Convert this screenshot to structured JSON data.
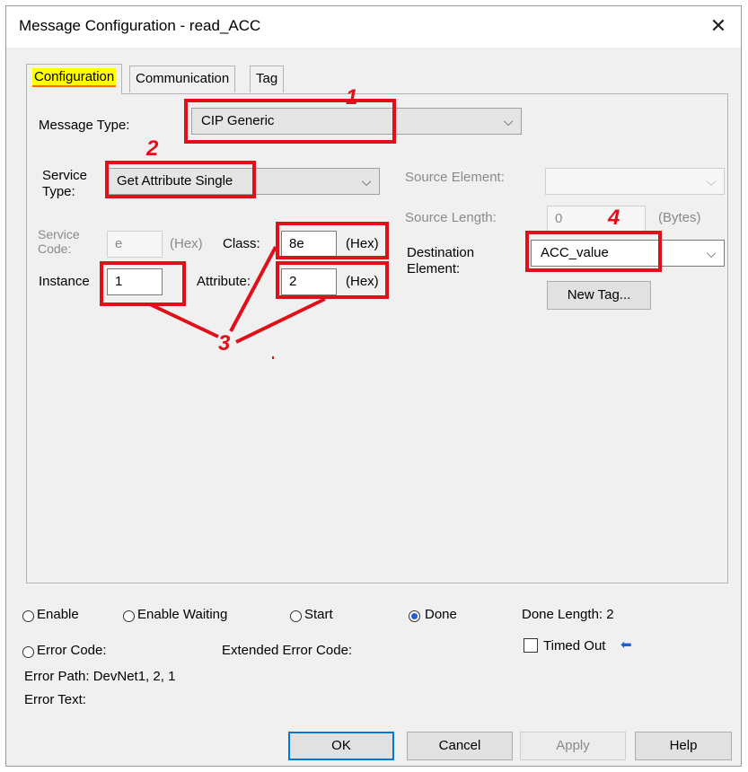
{
  "window": {
    "title": "Message Configuration - read_ACC",
    "close_symbol": "✕"
  },
  "tabs": [
    {
      "label": "Configuration",
      "active": true
    },
    {
      "label": "Communication",
      "active": false
    },
    {
      "label": "Tag",
      "active": false
    }
  ],
  "config": {
    "message_type_label": "Message Type:",
    "message_type_value": "CIP Generic",
    "service_type_label_1": "Service",
    "service_type_label_2": "Type:",
    "service_type_value": "Get Attribute Single",
    "service_code_label_1": "Service",
    "service_code_label_2": "Code:",
    "service_code_value": "e",
    "service_code_unit": "(Hex)",
    "class_label": "Class:",
    "class_value": "8e",
    "class_unit": "(Hex)",
    "instance_label": "Instance",
    "instance_value": "1",
    "attribute_label": "Attribute:",
    "attribute_value": "2",
    "attribute_unit": "(Hex)",
    "source_element_label": "Source Element:",
    "source_element_value": "",
    "source_length_label": "Source Length:",
    "source_length_value": "0",
    "source_length_unit": "(Bytes)",
    "destination_label_1": "Destination",
    "destination_label_2": "Element:",
    "destination_value": "ACC_value",
    "new_tag_label": "New Tag..."
  },
  "annotations": {
    "n1": "1",
    "n2": "2",
    "n3": "3",
    "n4": "4",
    "color": "#e0101a"
  },
  "status": {
    "enable": "Enable",
    "enable_waiting": "Enable Waiting",
    "start": "Start",
    "done": "Done",
    "done_length": "Done Length: 2",
    "error_code": "Error Code:",
    "extended_error_code": "Extended Error Code:",
    "timed_out": "Timed Out",
    "timed_out_arrow": "⬅",
    "error_path": "Error Path: DevNet1, 2, 1",
    "error_text": "Error Text:"
  },
  "buttons": {
    "ok": "OK",
    "cancel": "Cancel",
    "apply": "Apply",
    "help": "Help"
  },
  "icons": {
    "dropdown": "chevron-down-icon"
  }
}
